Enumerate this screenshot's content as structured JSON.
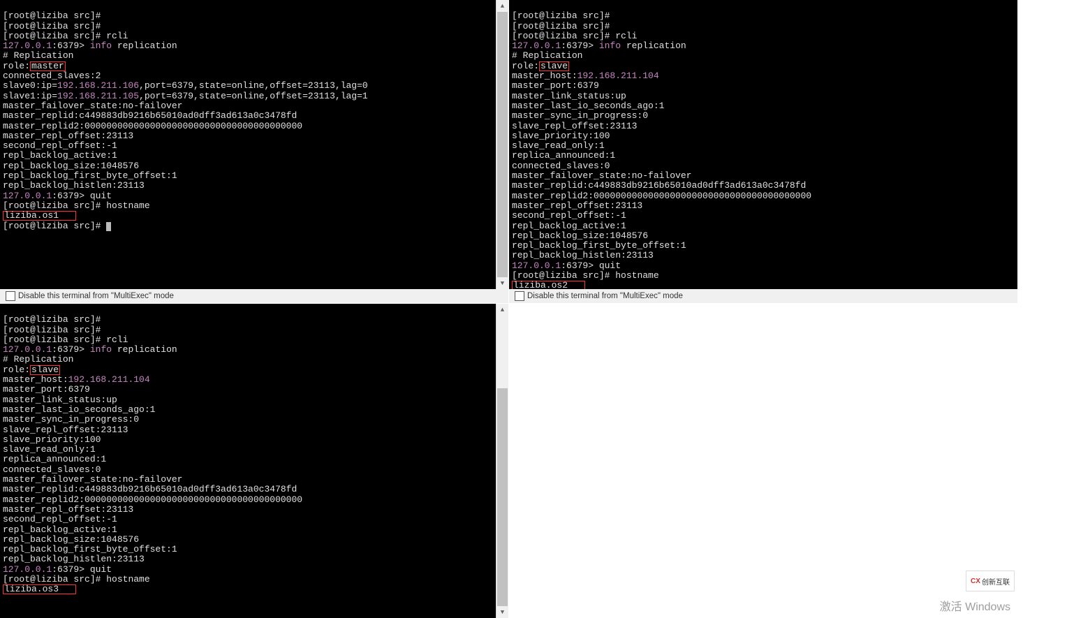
{
  "shared": {
    "promptPrefix": "[root@liziba src]#",
    "redisPromptIp": "127.0.0.1",
    "redisPromptPort": ":6379>",
    "rcliCmd": " rcli",
    "infoCmd": "info",
    "replicationArg": " replication",
    "replicationHeader": "# Replication",
    "quitCmd": " quit",
    "hostnameCmd": " hostname",
    "footerLabel": "Disable this terminal from \"MultiExec\" mode"
  },
  "pane1": {
    "roleLabel": "role:",
    "roleValue": "master",
    "connectedSlaves": "connected_slaves:2",
    "slave0prefix": "slave0:ip=",
    "slave0ip": "192.168.211.106",
    "slave0suffix": ",port=6379,state=online,offset=23113,lag=0",
    "slave1prefix": "slave1:ip=",
    "slave1ip": "192.168.211.105",
    "slave1suffix": ",port=6379,state=online,offset=23113,lag=1",
    "failover": "master_failover_state:no-failover",
    "replid": "master_replid:c449883db9216b65010ad0dff3ad613a0c3478fd",
    "replid2": "master_replid2:0000000000000000000000000000000000000000",
    "replOffset": "master_repl_offset:23113",
    "secondOffset": "second_repl_offset:-1",
    "backlogActive": "repl_backlog_active:1",
    "backlogSize": "repl_backlog_size:1048576",
    "backlogFirst": "repl_backlog_first_byte_offset:1",
    "backlogHistlen": "repl_backlog_histlen:23113",
    "hostname": "liziba.os1"
  },
  "pane2": {
    "roleLabel": "role:",
    "roleValue": "slave",
    "masterHostLabel": "master_host:",
    "masterHostValue": "192.168.211.104",
    "masterPort": "master_port:6379",
    "linkStatus": "master_link_status:up",
    "lastIo": "master_last_io_seconds_ago:1",
    "syncProgress": "master_sync_in_progress:0",
    "slaveOffset": "slave_repl_offset:23113",
    "slavePriority": "slave_priority:100",
    "slaveReadonly": "slave_read_only:1",
    "replicaAnnounced": "replica_announced:1",
    "connectedSlaves": "connected_slaves:0",
    "failover": "master_failover_state:no-failover",
    "replid": "master_replid:c449883db9216b65010ad0dff3ad613a0c3478fd",
    "replid2": "master_replid2:0000000000000000000000000000000000000000",
    "replOffset": "master_repl_offset:23113",
    "secondOffset": "second_repl_offset:-1",
    "backlogActive": "repl_backlog_active:1",
    "backlogSize": "repl_backlog_size:1048576",
    "backlogFirst": "repl_backlog_first_byte_offset:1",
    "backlogHistlen": "repl_backlog_histlen:23113",
    "hostname": "liziba.os2"
  },
  "pane3": {
    "roleLabel": "role:",
    "roleValue": "slave",
    "masterHostLabel": "master_host:",
    "masterHostValue": "192.168.211.104",
    "masterPort": "master_port:6379",
    "linkStatus": "master_link_status:up",
    "lastIo": "master_last_io_seconds_ago:1",
    "syncProgress": "master_sync_in_progress:0",
    "slaveOffset": "slave_repl_offset:23113",
    "slavePriority": "slave_priority:100",
    "slaveReadonly": "slave_read_only:1",
    "replicaAnnounced": "replica_announced:1",
    "connectedSlaves": "connected_slaves:0",
    "failover": "master_failover_state:no-failover",
    "replid": "master_replid:c449883db9216b65010ad0dff3ad613a0c3478fd",
    "replid2": "master_replid2:0000000000000000000000000000000000000000",
    "replOffset": "master_repl_offset:23113",
    "secondOffset": "second_repl_offset:-1",
    "backlogActive": "repl_backlog_active:1",
    "backlogSize": "repl_backlog_size:1048576",
    "backlogFirst": "repl_backlog_first_byte_offset:1",
    "backlogHistlen": "repl_backlog_histlen:23113",
    "hostname": "liziba.os3"
  },
  "pane4": {
    "watermark": "激活 Windows",
    "logoText": "创新互联"
  }
}
